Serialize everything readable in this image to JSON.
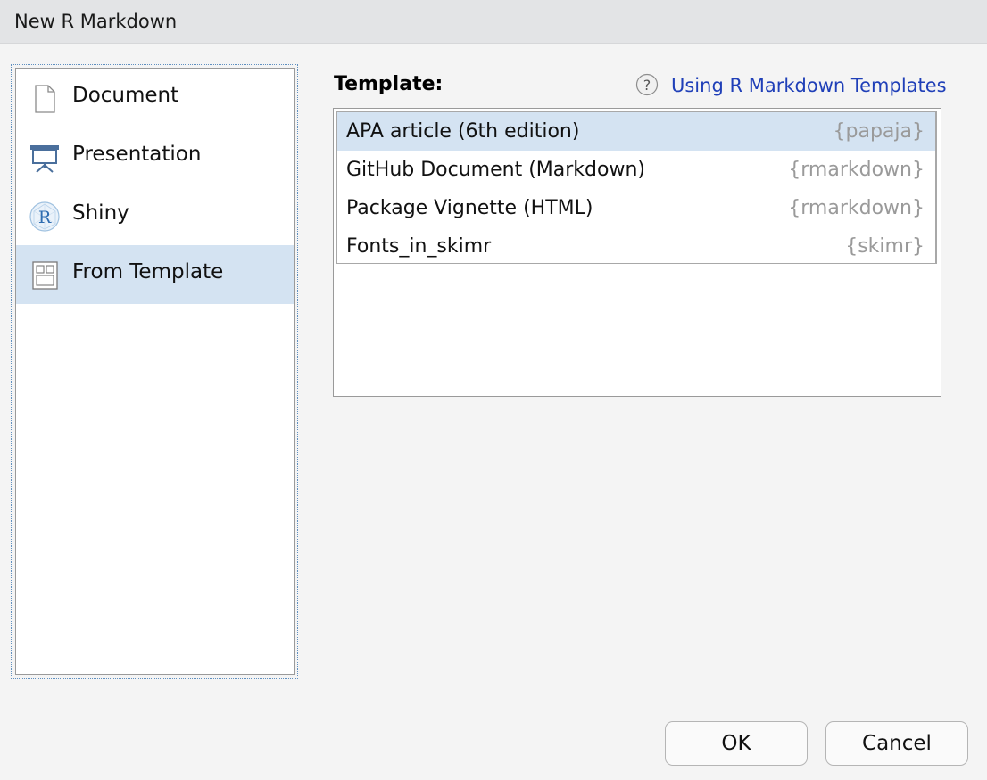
{
  "window": {
    "title": "New R Markdown"
  },
  "sidebar": {
    "items": [
      {
        "label": "Document",
        "icon": "document-icon",
        "selected": false
      },
      {
        "label": "Presentation",
        "icon": "presentation-icon",
        "selected": false
      },
      {
        "label": "Shiny",
        "icon": "shiny-r-icon",
        "selected": false
      },
      {
        "label": "From Template",
        "icon": "template-icon",
        "selected": true
      }
    ]
  },
  "template_section": {
    "label": "Template:",
    "help_link": "Using R Markdown Templates",
    "templates": [
      {
        "name": "APA article (6th edition)",
        "package": "{papaja}",
        "selected": true
      },
      {
        "name": "GitHub Document (Markdown)",
        "package": "{rmarkdown}",
        "selected": false
      },
      {
        "name": "Package Vignette (HTML)",
        "package": "{rmarkdown}",
        "selected": false
      },
      {
        "name": "Fonts_in_skimr",
        "package": "{skimr}",
        "selected": false
      }
    ]
  },
  "buttons": {
    "ok": "OK",
    "cancel": "Cancel"
  },
  "colors": {
    "selection": "#d4e3f2",
    "link": "#1f3fb8",
    "package_text": "#9a9a9a",
    "icon_blue": "#4a6f9c"
  }
}
